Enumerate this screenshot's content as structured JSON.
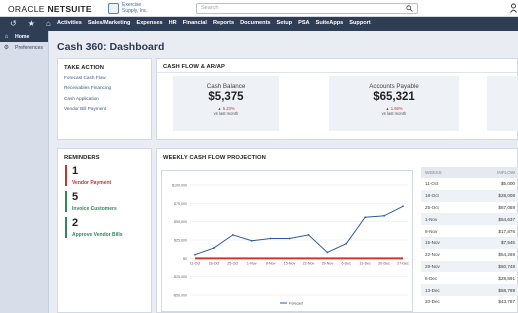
{
  "brand": {
    "logo_oracle": "ORACLE",
    "logo_netsuite": "NETSUITE"
  },
  "company": {
    "line1": "Exercise",
    "line2": "Supply, Inc."
  },
  "search": {
    "placeholder": "Search"
  },
  "nav": {
    "menu": [
      "Activities",
      "Sales/Marketing",
      "Expenses",
      "HR",
      "Financial",
      "Reports",
      "Documents",
      "Setup",
      "PSA",
      "SuiteApps",
      "Support"
    ]
  },
  "sidebar": {
    "items": [
      {
        "label": "Home",
        "icon": "home-icon"
      },
      {
        "label": "Preferences",
        "icon": "preferences-icon"
      }
    ]
  },
  "page": {
    "title": "Cash 360: Dashboard"
  },
  "take_action": {
    "title": "TAKE ACTION",
    "links": [
      "Forecast Cash Flow",
      "Receivables Financing",
      "Cash Application",
      "Vendor Bill Payment"
    ]
  },
  "cash_flow": {
    "title": "CASH FLOW & AR/AP",
    "metrics": [
      {
        "label": "Cash Balance",
        "value": "$5,375",
        "change": "▲ 5.23%",
        "sub": "vs last month"
      },
      {
        "label": "Accounts Payable",
        "value": "$65,321",
        "change": "▲ 1.69%",
        "sub": "vs last month"
      }
    ]
  },
  "reminders": {
    "title": "REMINDERS",
    "items": [
      {
        "count": "1",
        "label": "Vendor Payment",
        "color": "#c7352e"
      },
      {
        "count": "5",
        "label": "Invoice Customers",
        "color": "#2e8b57"
      },
      {
        "count": "2",
        "label": "Approve Vendor Bills",
        "color": "#2e8b57"
      }
    ]
  },
  "weekly": {
    "title": "WEEKLY CASH FLOW PROJECTION",
    "table": {
      "headers": [
        "WEEKS",
        "INFLOW"
      ],
      "rows": [
        [
          "11-Oct",
          "$5,000"
        ],
        [
          "18-Oct",
          "$28,008"
        ],
        [
          "25-Oct",
          "$87,088"
        ],
        [
          "1-Nov",
          "$54,637"
        ],
        [
          "8-Nov",
          "$17,876"
        ],
        [
          "15-Nov",
          "$7,545"
        ],
        [
          "22-Nov",
          "$54,269"
        ],
        [
          "29-Nov",
          "$60,748"
        ],
        [
          "6-Dec",
          "$28,891"
        ],
        [
          "13-Dec",
          "$58,789"
        ],
        [
          "20-Dec",
          "$43,787"
        ]
      ]
    }
  },
  "chart_data": {
    "type": "line",
    "y_tick_labels": [
      "$100,000",
      "$75,000",
      "$50,000",
      "$25,000",
      "$0",
      "-$25,000",
      "-$50,000"
    ],
    "ylim": [
      -50000,
      100000
    ],
    "categories": [
      "11-Oct",
      "18-Oct",
      "25-Oct",
      "1-Nov",
      "8-Nov",
      "15-Nov",
      "22-Nov",
      "29-Nov",
      "6-Dec",
      "13-Dec",
      "20-Dec",
      "27-Dec"
    ],
    "series": [
      {
        "name": "Forecast",
        "values": [
          5000,
          14000,
          32000,
          24000,
          27000,
          27000,
          32000,
          8000,
          20000,
          56000,
          58000,
          71000
        ],
        "color": "#2c5aa0"
      },
      {
        "values": [
          0,
          0,
          0,
          0,
          0,
          0,
          0,
          0,
          0,
          0,
          0,
          0
        ],
        "color": "#d7342b"
      }
    ],
    "legend": "bottom",
    "grid": true
  }
}
